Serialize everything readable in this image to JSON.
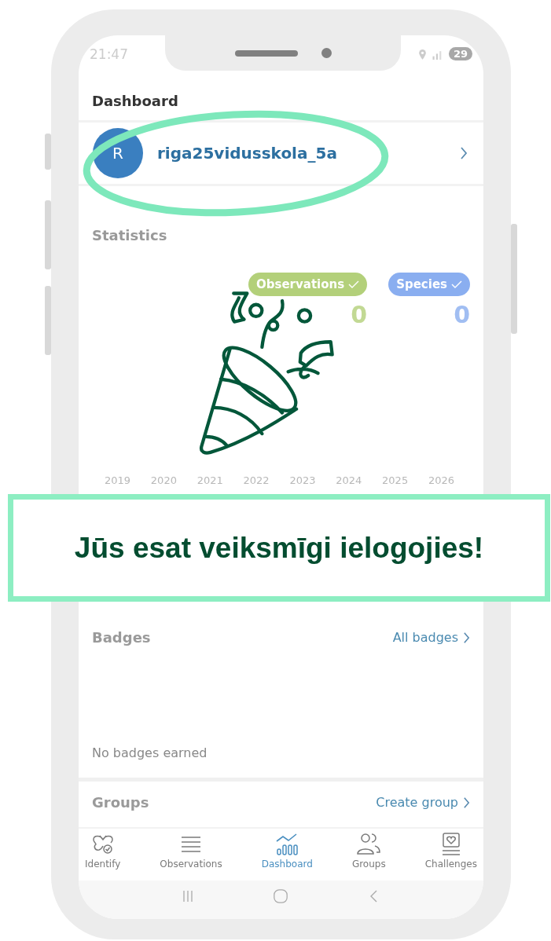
{
  "status_bar": {
    "time": "21:47",
    "battery": "29"
  },
  "header": {
    "title": "Dashboard"
  },
  "profile": {
    "initial": "R",
    "username": "riga25vidusskola_5a"
  },
  "statistics": {
    "title": "Statistics",
    "counters": [
      {
        "label": "Observations",
        "value": "0",
        "color": "#b3d07a",
        "checked": true
      },
      {
        "label": "Species",
        "value": "0",
        "color": "#8aaef0",
        "checked": true
      }
    ],
    "years": [
      "2019",
      "2020",
      "2021",
      "2022",
      "2023",
      "2024",
      "2025",
      "2026"
    ]
  },
  "banner": {
    "text": "Jūs esat veiksmīgi ielogojies!"
  },
  "badges": {
    "title": "Badges",
    "link": "All badges",
    "empty": "No badges earned"
  },
  "groups": {
    "title": "Groups",
    "link": "Create group"
  },
  "nav": [
    {
      "label": "Identify",
      "kind": "identify",
      "selected": false
    },
    {
      "label": "Observations",
      "kind": "list",
      "selected": false
    },
    {
      "label": "Dashboard",
      "kind": "chart",
      "selected": true
    },
    {
      "label": "Groups",
      "kind": "people",
      "selected": false
    },
    {
      "label": "Challenges",
      "kind": "heart",
      "selected": false
    }
  ]
}
